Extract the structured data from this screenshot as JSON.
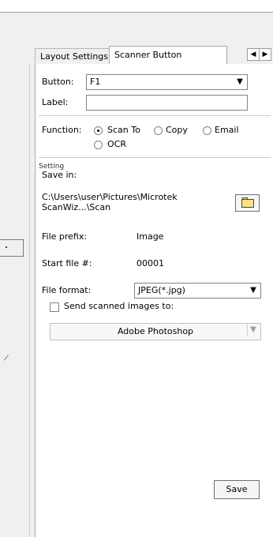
{
  "tabs": [
    "Layout Settings",
    "Scanner Button"
  ],
  "button_label": "Button:",
  "button_value": "F1",
  "label_label": "Label:",
  "label_value": "",
  "function_label": "Function:",
  "function_options": [
    "Scan To",
    "Copy",
    "Email",
    "OCR"
  ],
  "selected_function": "Scan To",
  "setting_group": "Setting",
  "save_in_label": "Save in:",
  "save_path_line1": "C:\\Users\\user\\Pictures\\Microtek",
  "save_path_line2": "ScanWiz...\\Scan",
  "file_prefix_label": "File prefix:",
  "file_prefix_value": "Image",
  "start_file_label": "Start file #:",
  "start_file_value": "00001",
  "file_format_label": "File format:",
  "file_format_value": "JPEG(*.jpg)",
  "send_images_label": "Send scanned images to:",
  "send_images_checked": false,
  "send_target_value": "Adobe Photoshop",
  "save_button": "Save",
  "icons": {
    "browse": "folder-icon",
    "dropdown": "chevron-down-icon",
    "scroll_left": "triangle-left-icon",
    "scroll_right": "triangle-right-icon"
  }
}
